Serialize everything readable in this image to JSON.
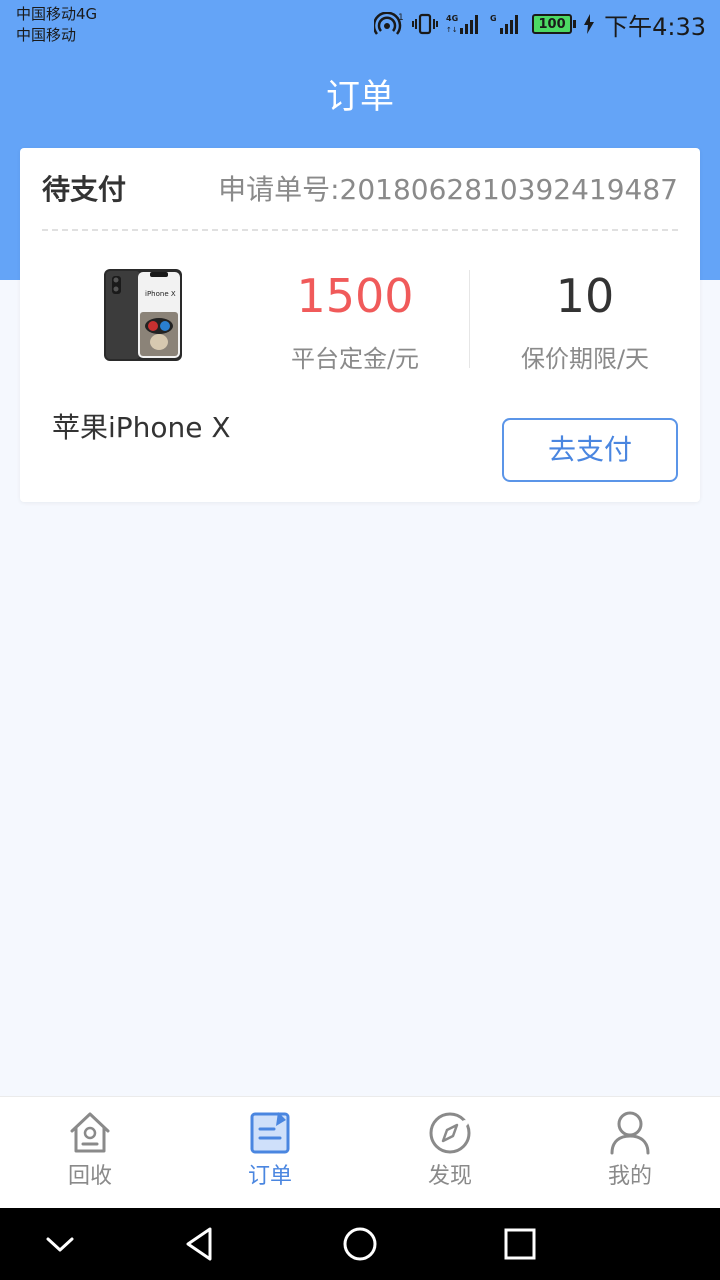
{
  "status_bar": {
    "carrier_line1": "中国移动4G",
    "carrier_line2": "中国移动",
    "battery": "100",
    "time": "下午4:33",
    "icons": [
      "hotspot-icon",
      "vibrate-icon",
      "4g-signal-icon",
      "g-signal-icon",
      "battery-icon",
      "charging-icon"
    ]
  },
  "header": {
    "title": "订单"
  },
  "order": {
    "status": "待支付",
    "order_no_text": "申请单号:2018062810392419487",
    "product_name": "苹果iPhone X",
    "deposit_value": "1500",
    "deposit_label": "平台定金/元",
    "period_value": "10",
    "period_label": "保价期限/天",
    "pay_button_label": "去支付"
  },
  "tabs": [
    {
      "label": "回收",
      "icon": "home-icon",
      "active": false
    },
    {
      "label": "订单",
      "icon": "order-icon",
      "active": true
    },
    {
      "label": "发现",
      "icon": "compass-icon",
      "active": false
    },
    {
      "label": "我的",
      "icon": "user-icon",
      "active": false
    }
  ],
  "navigation": {
    "icons": [
      "collapse-icon",
      "back-icon",
      "home-circle-icon",
      "recents-icon"
    ]
  },
  "colors": {
    "header": "#64a4f7",
    "accent": "#4a86e0",
    "price": "#f05a5a",
    "background": "#f5f8fe"
  }
}
